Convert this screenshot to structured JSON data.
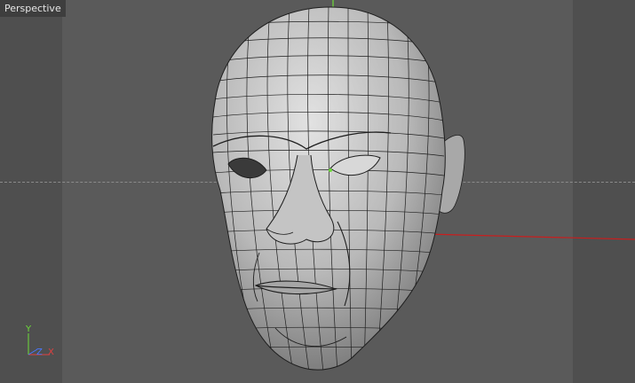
{
  "viewport": {
    "view_name": "Perspective",
    "background_color": "#5a5a5a",
    "mesh_color": "#bdbdbd",
    "wire_color": "#1e1e1e",
    "x_axis_color": "#c81e1e"
  },
  "axis_gizmo": {
    "y_label": "Y",
    "z_label": "Z",
    "x_label": "X",
    "y_color": "#6ddc3a",
    "z_color": "#4a78ff",
    "x_color": "#e04040"
  }
}
